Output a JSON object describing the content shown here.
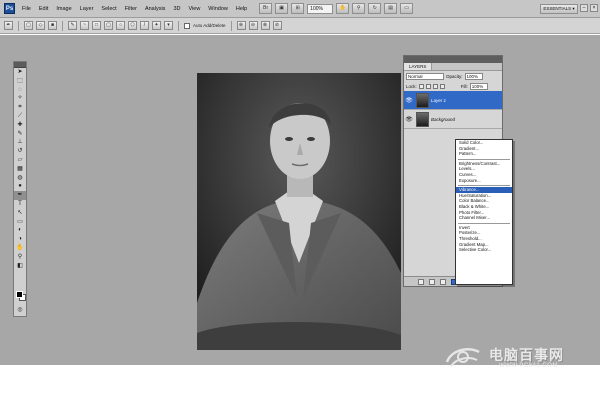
{
  "app": {
    "logo_text": "Ps",
    "menu": [
      "File",
      "Edit",
      "Image",
      "Layer",
      "Select",
      "Filter",
      "Analysis",
      "3D",
      "View",
      "Window",
      "Help"
    ],
    "zoom": "100%",
    "workspace_button": "ESSENTIALS ▾"
  },
  "options_bar": {
    "auto_add_delete_label": "Auto Add/Delete"
  },
  "layers_panel": {
    "tab": "LAYERS",
    "blend_mode": "Normal",
    "opacity_label": "Opacity:",
    "opacity_value": "100%",
    "lock_label": "Lock:",
    "fill_label": "Fill:",
    "fill_value": "100%",
    "layers": [
      {
        "name": "Layer 1",
        "active": true
      },
      {
        "name": "Background",
        "active": false
      }
    ]
  },
  "adjustment_menu": {
    "groups": [
      [
        "Solid Color...",
        "Gradient...",
        "Pattern..."
      ],
      [
        "Brightness/Contrast...",
        "Levels...",
        "Curves...",
        "Exposure..."
      ],
      [
        "Vibrance...",
        "Hue/Saturation...",
        "Color Balance...",
        "Black & White...",
        "Photo Filter...",
        "Channel Mixer..."
      ],
      [
        "Invert",
        "Posterize...",
        "Threshold...",
        "Gradient Map...",
        "Selective Color..."
      ]
    ],
    "highlighted": "Vibrance..."
  },
  "watermark": {
    "title": "电脑百事网",
    "url": "WWW.PC841.COM"
  },
  "colors": {
    "workspace": "#a7a7a7",
    "selection_blue": "#2a5fb8",
    "menubar": "#c6c6c6"
  }
}
